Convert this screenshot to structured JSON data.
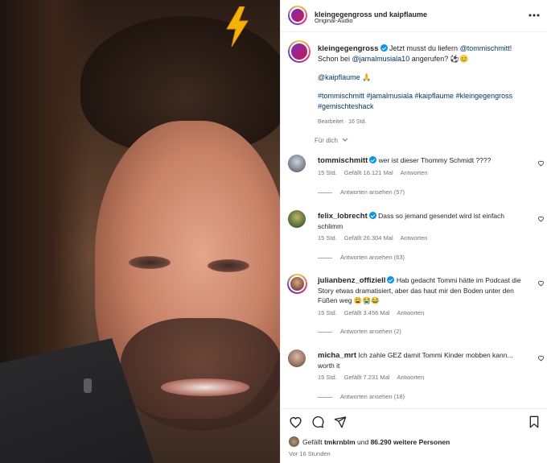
{
  "post": {
    "author": "kleingegengross",
    "collab": "kaipflaume",
    "header_title": "kleingegengross und kaipflaume",
    "audio": "Original-Audio",
    "caption_line1_pre": "Jetzt musst du liefern ",
    "caption_mention1": "@tommischmitt",
    "caption_line1_post": "!",
    "caption_line2_pre": "Schon bei ",
    "caption_mention2": "@jamalmusiala10",
    "caption_line2_post": " angerufen? ⚽️😊",
    "caption_mention3": "@kaipflaume 🙏",
    "hashtags_line1": "#tommischmitt #jamalmusiala #kaipflaume #kleingegengross",
    "hashtags_line2": "#gemischteshack",
    "edited": "Bearbeitet · 16 Std."
  },
  "for_you": "Für dich",
  "comments": [
    {
      "user": "tommischmitt",
      "text": "wer ist dieser Thommy Schmidt ????",
      "time": "15 Std.",
      "likes": "Gefällt 16.121 Mal",
      "reply": "Antworten",
      "view_replies": "Antworten ansehen (57)"
    },
    {
      "user": "felix_lobrecht",
      "text": "Dass so jemand gesendet wird ist einfach schlimm",
      "time": "15 Std.",
      "likes": "Gefällt 26.304 Mal",
      "reply": "Antworten",
      "view_replies": "Antworten ansehen (63)"
    },
    {
      "user": "julianbenz_offiziell",
      "text": "Hab gedacht Tommi hätte im Podcast die Story etwas dramatisiert, aber das haut mir den Boden unter den Füßen weg 😩😭😂",
      "time": "15 Std.",
      "likes": "Gefällt 3.456 Mal",
      "reply": "Antworten",
      "view_replies": "Antworten ansehen (2)"
    },
    {
      "user": "micha_mrt",
      "text": "Ich zahle GEZ damit Tommi Kinder mobben kann... worth it",
      "time": "15 Std.",
      "likes": "Gefällt 7.231 Mal",
      "reply": "Antworten",
      "view_replies": "Antworten ansehen (18)"
    }
  ],
  "footer": {
    "liked_prefix": "Gefällt ",
    "liked_user": "tmkrnblm",
    "liked_mid": " und ",
    "liked_others": "86.290 weitere Personen",
    "posted": "Vor 16 Stunden"
  },
  "icons": {
    "more": "more-options-icon",
    "like": "heart-icon",
    "comment": "comment-icon",
    "share": "share-icon",
    "save": "bookmark-icon"
  },
  "colors": {
    "link": "#00376b",
    "verified": "#0095f6",
    "meta": "#737373"
  }
}
